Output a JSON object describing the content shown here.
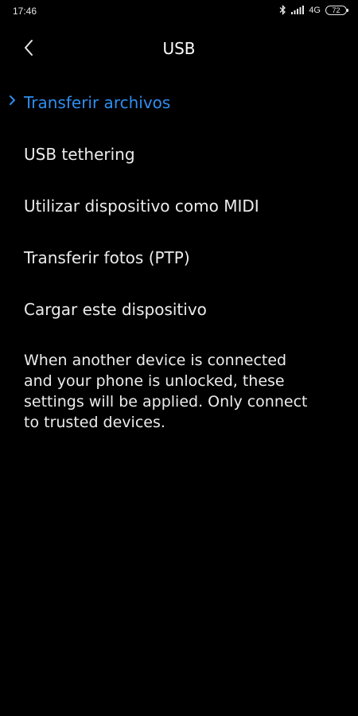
{
  "status_bar": {
    "time": "17:46",
    "network": "4G",
    "battery": "72",
    "icons": [
      "bluetooth-icon",
      "signal-icon"
    ]
  },
  "header": {
    "back_icon": "chevron-left-icon",
    "title": "USB"
  },
  "options": [
    {
      "label": "Transferir archivos",
      "selected": true
    },
    {
      "label": "USB tethering",
      "selected": false
    },
    {
      "label": "Utilizar dispositivo como MIDI",
      "selected": false
    },
    {
      "label": "Transferir fotos (PTP)",
      "selected": false
    },
    {
      "label": "Cargar este dispositivo",
      "selected": false
    }
  ],
  "info_text": "When another device is connected and your phone is unlocked, these settings will be applied. Only connect to trusted devices.",
  "colors": {
    "background": "#000000",
    "accent": "#2f8ef0",
    "text": "#ececec"
  }
}
